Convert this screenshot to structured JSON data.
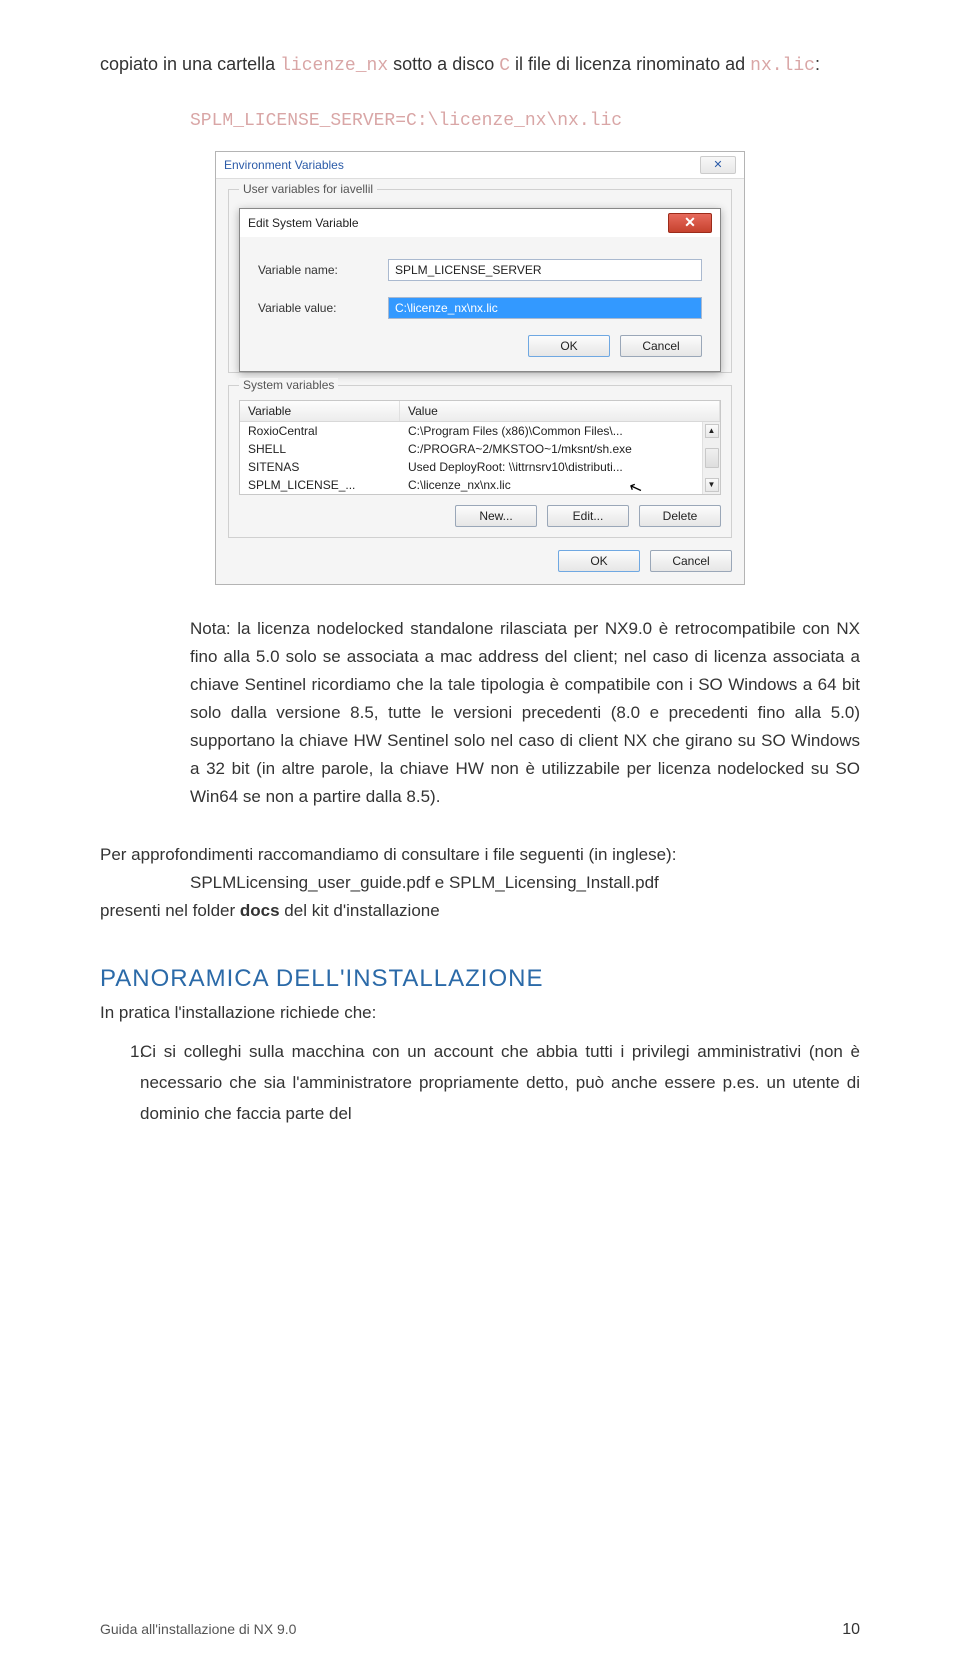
{
  "intro": {
    "prefix": "copiato in una cartella ",
    "folder": "licenze_nx",
    "mid1": " sotto a disco ",
    "drive": "C",
    "mid2": " il file di licenza rinominato ad ",
    "renamed": "nx.lic",
    "colon": ":"
  },
  "server_line": "SPLM_LICENSE_SERVER=C:\\licenze_nx\\nx.lic",
  "env_window": {
    "title": "Environment Variables",
    "close_glyph": "✕",
    "user_group_label": "User variables for iavellil",
    "inner_dialog": {
      "title": "Edit System Variable",
      "close_glyph": "✕",
      "name_label": "Variable name:",
      "name_value": "SPLM_LICENSE_SERVER",
      "value_label": "Variable value:",
      "value_value": "C:\\licenze_nx\\nx.lic",
      "ok": "OK",
      "cancel": "Cancel"
    },
    "sys_group_label": "System variables",
    "sys_head_var": "Variable",
    "sys_head_val": "Value",
    "sys_rows": [
      {
        "var": "RoxioCentral",
        "val": "C:\\Program Files (x86)\\Common Files\\..."
      },
      {
        "var": "SHELL",
        "val": "C:/PROGRA~2/MKSTOO~1/mksnt/sh.exe"
      },
      {
        "var": "SITENAS",
        "val": "Used DeployRoot: \\\\ittrnsrv10\\distributi..."
      },
      {
        "var": "SPLM_LICENSE_...",
        "val": "C:\\licenze_nx\\nx.lic"
      }
    ],
    "scroll_up": "▲",
    "scroll_down": "▼",
    "cursor": "↖",
    "new_btn": "New...",
    "edit_btn": "Edit...",
    "delete_btn": "Delete",
    "ok": "OK",
    "cancel": "Cancel"
  },
  "nota_paragraph": "Nota: la licenza nodelocked standalone rilasciata per NX9.0 è retrocompatibile con NX fino alla 5.0 solo se associata a mac address del client; nel caso di licenza associata a chiave Sentinel ricordiamo che la tale tipologia è compatibile con i SO Windows a  64 bit solo dalla versione 8.5, tutte le versioni precedenti (8.0 e precedenti fino alla 5.0) supportano la chiave HW Sentinel solo nel caso di client NX che girano su SO Windows a 32 bit (in altre parole, la chiave HW non è utilizzabile per licenza nodelocked su SO Win64 se non a partire dalla 8.5).",
  "recommend_line": "Per approfondimenti raccomandiamo di consultare i file seguenti (in inglese):",
  "recommend_files": "SPLMLicensing_user_guide.pdf e SPLM_Licensing_Install.pdf",
  "recommend_presence_prefix": "presenti nel folder ",
  "recommend_presence_bold": "docs",
  "recommend_presence_suffix": " del kit d'installazione",
  "heading_panoramica": "PANORAMICA DELL'INSTALLAZIONE",
  "pratica_line": "In pratica l'installazione richiede che:",
  "list_item1_num": "1.",
  "list_item1": "Ci si colleghi sulla macchina con un account che abbia tutti i privilegi amministrativi (non è necessario che sia l'amministratore propriamente detto,  può anche essere p.es. un utente di dominio che faccia parte del",
  "footer_left": "Guida all'installazione di NX 9.0",
  "footer_right": "10"
}
